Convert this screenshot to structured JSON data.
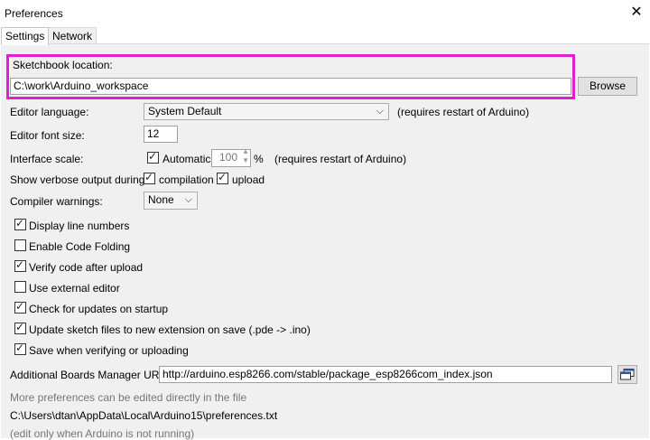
{
  "window": {
    "title": "Preferences",
    "close_icon": "close-icon"
  },
  "tabs": [
    {
      "label": "Settings"
    },
    {
      "label": "Network"
    }
  ],
  "sketchbook": {
    "label": "Sketchbook location:",
    "value": "C:\\work\\Arduino_workspace",
    "browse_label": "Browse"
  },
  "editor_language": {
    "label": "Editor language:",
    "value": "System Default",
    "note": "(requires restart of Arduino)"
  },
  "editor_font_size": {
    "label": "Editor font size:",
    "value": "12"
  },
  "interface_scale": {
    "label": "Interface scale:",
    "automatic_label": "Automatic",
    "value": "100",
    "unit": "%",
    "note": "(requires restart of Arduino)"
  },
  "verbose": {
    "label": "Show verbose output during:",
    "compilation_label": "compilation",
    "upload_label": "upload"
  },
  "compiler_warnings": {
    "label": "Compiler warnings:",
    "value": "None"
  },
  "checkboxes": [
    {
      "label": "Display line numbers",
      "checked": true
    },
    {
      "label": "Enable Code Folding",
      "checked": false
    },
    {
      "label": "Verify code after upload",
      "checked": true
    },
    {
      "label": "Use external editor",
      "checked": false
    },
    {
      "label": "Check for updates on startup",
      "checked": true
    },
    {
      "label": "Update sketch files to new extension on save (.pde -> .ino)",
      "checked": true
    },
    {
      "label": "Save when verifying or uploading",
      "checked": true
    }
  ],
  "boards_manager": {
    "label": "Additional Boards Manager URLs:",
    "value": "http://arduino.esp8266.com/stable/package_esp8266com_index.json"
  },
  "footer": {
    "more_prefs": "More preferences can be edited directly in the file",
    "path": "C:\\Users\\dtan\\AppData\\Local\\Arduino15\\preferences.txt",
    "note": "(edit only when Arduino is not running)"
  },
  "colors": {
    "highlight": "#e020d0",
    "panel": "#f0f0f0"
  }
}
